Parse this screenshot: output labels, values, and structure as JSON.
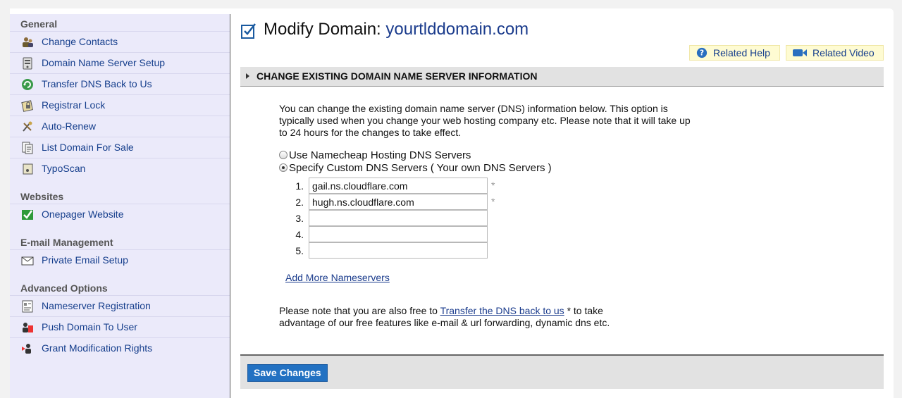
{
  "sidebar": {
    "sections": [
      {
        "title": "General",
        "items": [
          {
            "label": "Change Contacts",
            "icon": "contacts-icon"
          },
          {
            "label": "Domain Name Server Setup",
            "icon": "server-icon"
          },
          {
            "label": "Transfer DNS Back to Us",
            "icon": "transfer-icon"
          },
          {
            "label": "Registrar Lock",
            "icon": "lock-icon"
          },
          {
            "label": "Auto-Renew",
            "icon": "renew-icon"
          },
          {
            "label": "List Domain For Sale",
            "icon": "sale-list-icon"
          },
          {
            "label": "TypoScan",
            "icon": "typoscan-icon"
          }
        ]
      },
      {
        "title": "Websites",
        "items": [
          {
            "label": "Onepager Website",
            "icon": "checkmark-icon"
          }
        ]
      },
      {
        "title": "E-mail Management",
        "items": [
          {
            "label": "Private Email Setup",
            "icon": "envelope-icon"
          }
        ]
      },
      {
        "title": "Advanced Options",
        "items": [
          {
            "label": "Nameserver Registration",
            "icon": "registration-icon"
          },
          {
            "label": "Push Domain To User",
            "icon": "push-user-icon"
          },
          {
            "label": "Grant Modification Rights",
            "icon": "grant-user-icon"
          }
        ]
      }
    ]
  },
  "header": {
    "title_prefix": "Modify Domain:",
    "domain": "yourtlddomain.com",
    "related_help": "Related Help",
    "related_video": "Related Video"
  },
  "section": {
    "title": "CHANGE EXISTING DOMAIN NAME SERVER INFORMATION",
    "intro": "You can change the existing domain name server (DNS) information below. This option is typically used when you change your web hosting company etc. Please note that it will take up to 24 hours for the changes to take effect.",
    "options": [
      {
        "label": "Use Namecheap Hosting DNS Servers",
        "selected": false
      },
      {
        "label": "Specify Custom DNS Servers ( Your own DNS Servers )",
        "selected": true
      }
    ],
    "nameservers": [
      {
        "num": "1.",
        "value": "gail.ns.cloudflare.com",
        "required": "*"
      },
      {
        "num": "2.",
        "value": "hugh.ns.cloudflare.com",
        "required": "*"
      },
      {
        "num": "3.",
        "value": "",
        "required": ""
      },
      {
        "num": "4.",
        "value": "",
        "required": ""
      },
      {
        "num": "5.",
        "value": "",
        "required": ""
      }
    ],
    "add_more": "Add More Nameservers",
    "note_before": "Please note that you are also free to",
    "note_link": "Transfer the DNS back to us",
    "note_after_line1": "* to take",
    "note_line2": "advantage of our free features like e-mail & url forwarding, dynamic dns etc."
  },
  "footer": {
    "save_label": "Save Changes"
  },
  "colors": {
    "link": "#1a3b8c",
    "sidebar_bg": "#ebeafa",
    "save_button": "#2271c2",
    "help_bg": "#fefbd2"
  }
}
